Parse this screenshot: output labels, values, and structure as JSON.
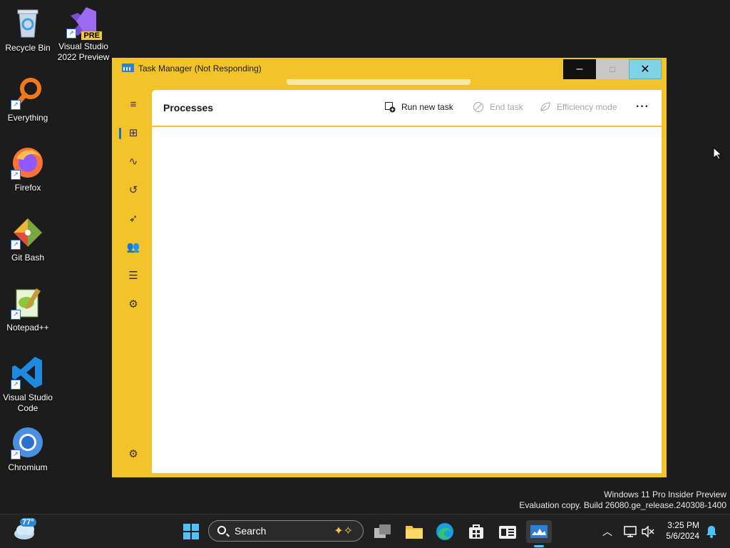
{
  "desktop": {
    "icons": [
      {
        "label": "Recycle Bin"
      },
      {
        "label": "Visual Studio 2022 Preview",
        "badge": "PRE"
      },
      {
        "label": "Everything"
      },
      {
        "label": "Firefox"
      },
      {
        "label": "Git Bash"
      },
      {
        "label": "Notepad++"
      },
      {
        "label": "Visual Studio Code"
      },
      {
        "label": "Chromium"
      }
    ],
    "watermark": {
      "line1": "Windows 11 Pro Insider Preview",
      "line2": "Evaluation copy. Build 26080.ge_release.240308-1400"
    }
  },
  "task_manager": {
    "title": "Task Manager (Not Responding)",
    "window_buttons": {
      "minimize": "–",
      "maximize": "□",
      "close": "✕"
    },
    "nav": [
      {
        "icon": "hamburger-menu-icon",
        "glyph": "≡"
      },
      {
        "icon": "processes-icon",
        "glyph": "⊞",
        "active": true
      },
      {
        "icon": "performance-icon",
        "glyph": "∿"
      },
      {
        "icon": "app-history-icon",
        "glyph": "↺"
      },
      {
        "icon": "startup-apps-icon",
        "glyph": "➶"
      },
      {
        "icon": "users-icon",
        "glyph": "👥"
      },
      {
        "icon": "details-icon",
        "glyph": "☰"
      },
      {
        "icon": "services-icon",
        "glyph": "⚙"
      }
    ],
    "settings_glyph": "⚙",
    "page_heading": "Processes",
    "toolbar": {
      "run_new_task": "Run new task",
      "end_task": "End task",
      "efficiency_mode": "Efficiency mode",
      "more": "···"
    }
  },
  "taskbar": {
    "weather_temp": "77°",
    "search_label": "Search",
    "clock_time": "3:25 PM",
    "clock_date": "5/6/2024"
  },
  "colors": {
    "window_accent": "#f2c42a",
    "taskbar_bg": "#202020",
    "desktop_bg": "#1c1c1c"
  }
}
